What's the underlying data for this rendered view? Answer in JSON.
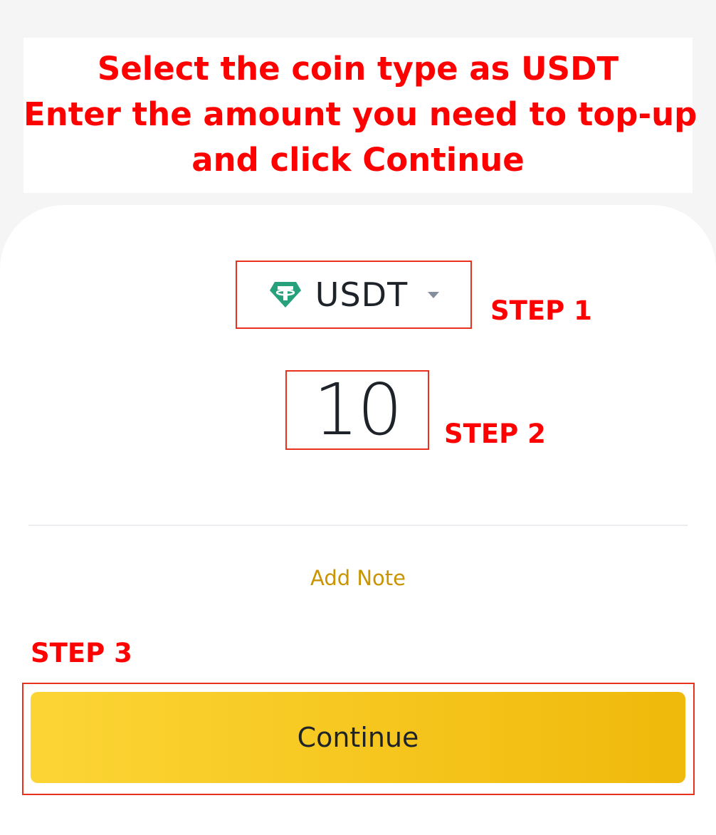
{
  "instructions": {
    "line1": "Select the coin type as USDT",
    "line2": "Enter the amount you need to top-up",
    "line3": "and click Continue"
  },
  "coin_selector": {
    "icon": "tether-icon",
    "coin": "USDT",
    "caret_icon": "caret-down-icon"
  },
  "amount": {
    "value": "10"
  },
  "add_note_label": "Add Note",
  "continue_label": "Continue",
  "steps": {
    "step1": "STEP 1",
    "step2": "STEP 2",
    "step3": "STEP 3"
  },
  "colors": {
    "annotation_red": "#ff0000",
    "highlight_frame": "#e8321e",
    "accent_yellow": "#fcd535",
    "accent_yellow_dark": "#f0b90b",
    "note_gold": "#c99400",
    "tether_green": "#26a17b",
    "text_dark": "#1e2329"
  }
}
